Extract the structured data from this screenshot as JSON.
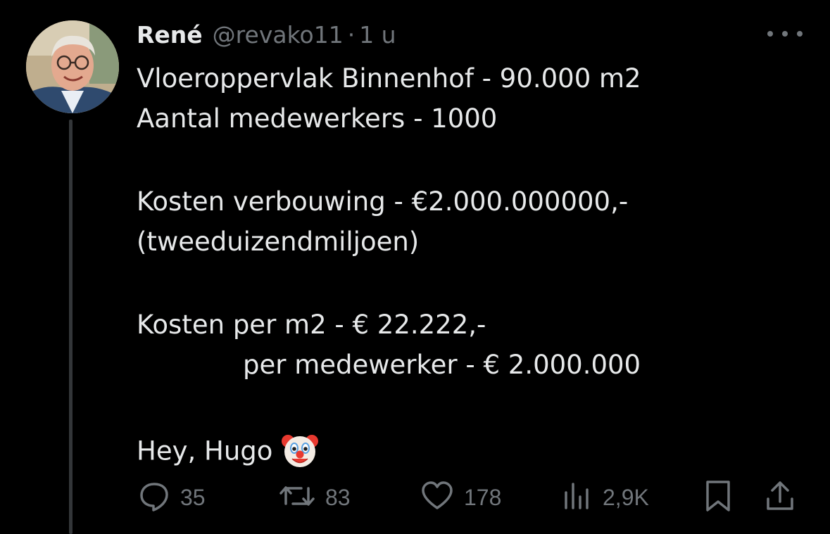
{
  "user": {
    "name": "René",
    "handle": "@revako11",
    "separator": "·",
    "time": "1 u"
  },
  "tweet": {
    "line1": "Vloeroppervlak Binnenhof - 90.000 m2",
    "line2": "Aantal medewerkers - 1000",
    "line3": "Kosten verbouwing - €2.000.000000,-",
    "line4": "(tweeduizendmiljoen)",
    "line5": "Kosten per m2 - € 22.222,-",
    "line6": "per medewerker - € 2.000.000",
    "line7": "Hey, Hugo",
    "emoji": "clown-face"
  },
  "actions": {
    "replies": "35",
    "retweets": "83",
    "likes": "178",
    "views": "2,9K"
  },
  "colors": {
    "background": "#000000",
    "text": "#e7e9ea",
    "secondary": "#71767b",
    "thread_line": "#333639"
  },
  "icons": [
    "avatar",
    "more-icon",
    "reply-icon",
    "retweet-icon",
    "like-icon",
    "views-icon",
    "bookmark-icon",
    "share-icon"
  ]
}
